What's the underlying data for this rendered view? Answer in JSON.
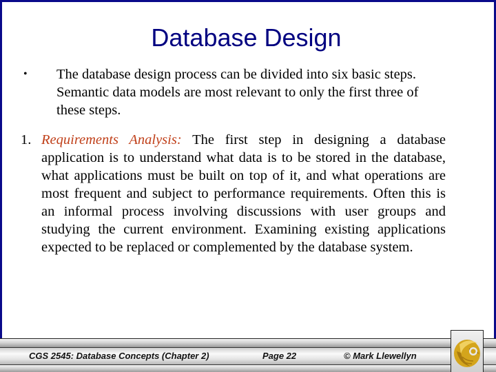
{
  "slide": {
    "title": "Database Design",
    "bullet": {
      "marker": "•",
      "text": "The database design process can be divided into six basic steps.  Semantic data models are most relevant to only the first three of these steps."
    },
    "step": {
      "number": "1.",
      "term": "Requirements Analysis:",
      "text": " The first step in designing a database application is to understand what data is to be stored in the database, what applications must be built on top of it, and what operations are most frequent and subject to performance requirements.  Often this is an informal process involving discussions with user groups and studying the current environment.  Examining existing applications expected to be replaced or complemented by the database system."
    }
  },
  "footer": {
    "course": "CGS 2545: Database Concepts  (Chapter 2)",
    "page": "Page 22",
    "copyright": "© Mark Llewellyn",
    "logo_icon": "pegasus-logo-icon"
  },
  "colors": {
    "frame": "#0a0a8a",
    "title": "#000080",
    "term": "#c0401a",
    "logo_gold": "#d4a51c"
  }
}
